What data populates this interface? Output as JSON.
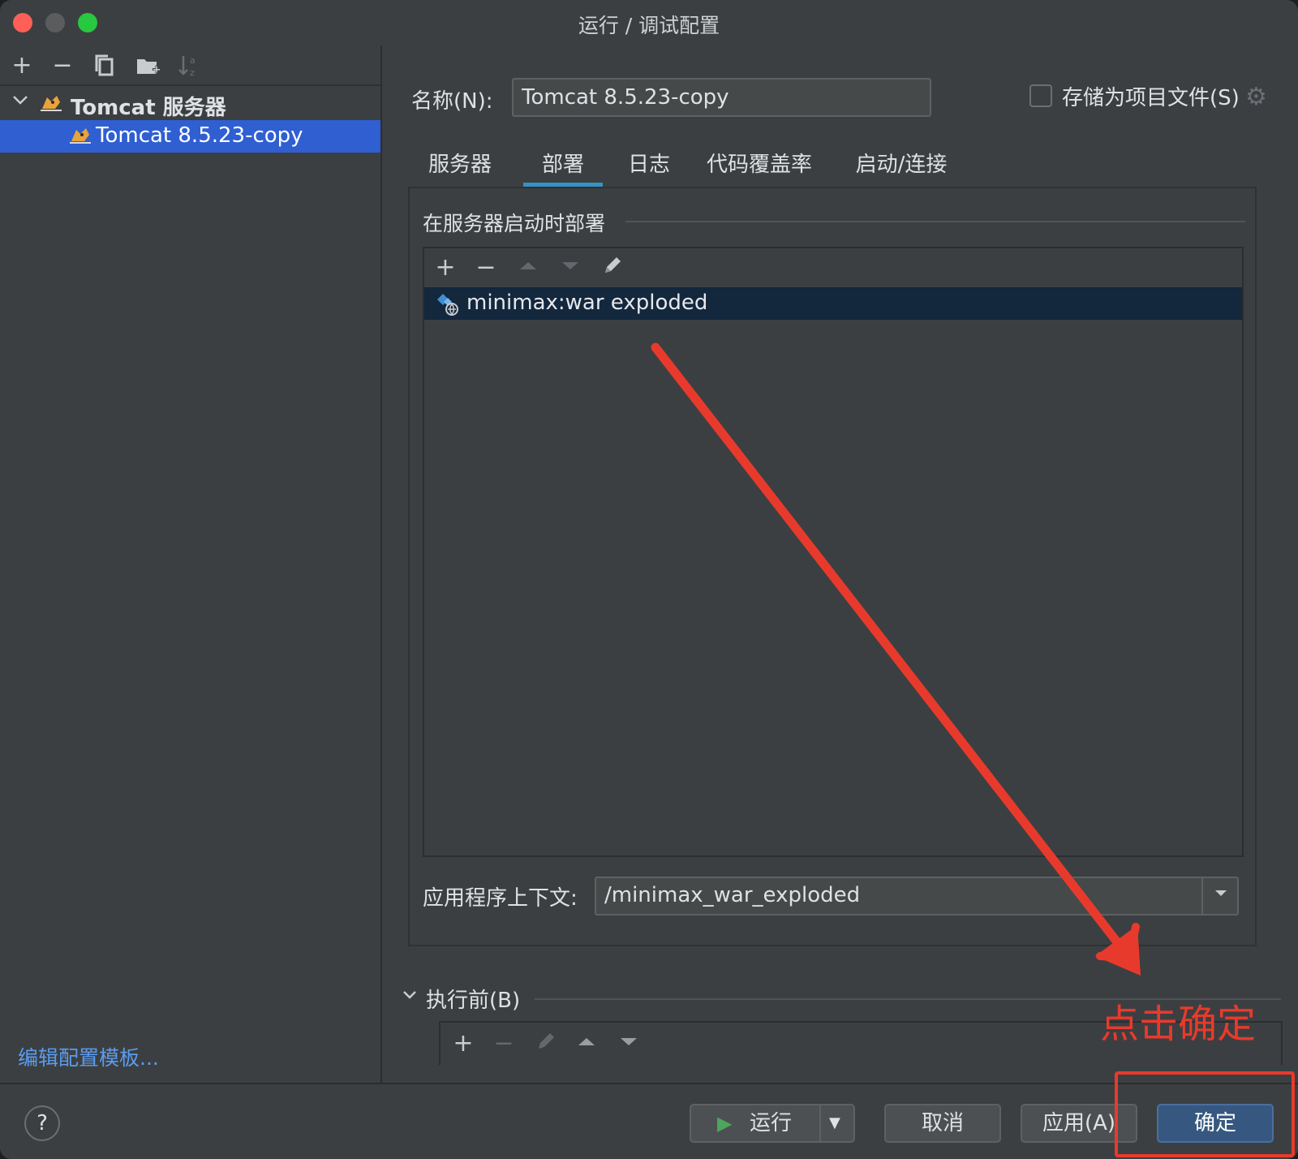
{
  "window": {
    "title": "运行 / 调试配置"
  },
  "left_panel": {
    "toolbar": [
      "add-icon",
      "remove-icon",
      "copy-icon",
      "folder-add-icon",
      "sort-icon"
    ],
    "tree": {
      "group_label": "Tomcat 服务器",
      "item_label": "Tomcat 8.5.23-copy"
    },
    "edit_templates_link": "编辑配置模板..."
  },
  "form": {
    "name_label": "名称(N):",
    "name_value": "Tomcat 8.5.23-copy",
    "store_label": "存储为项目文件(S)",
    "store_checked": false
  },
  "tabs": [
    {
      "label": "服务器",
      "active": false
    },
    {
      "label": "部署",
      "active": true
    },
    {
      "label": "日志",
      "active": false
    },
    {
      "label": "代码覆盖率",
      "active": false
    },
    {
      "label": "启动/连接",
      "active": false
    }
  ],
  "deploy": {
    "section_title": "在服务器启动时部署",
    "artifacts": [
      "minimax:war exploded"
    ],
    "context_label": "应用程序上下文:",
    "context_value": "/minimax_war_exploded"
  },
  "before_launch": {
    "label": "执行前(B)"
  },
  "buttons": {
    "run": "运行",
    "cancel": "取消",
    "apply": "应用(A)",
    "ok": "确定"
  },
  "annotation": {
    "text": "点击确定",
    "color": "#e83a2c"
  },
  "colors": {
    "selection": "#2f5fd1",
    "active_tab_underline": "#3592c4",
    "primary_button": "#365880",
    "link": "#5b9cf0"
  }
}
